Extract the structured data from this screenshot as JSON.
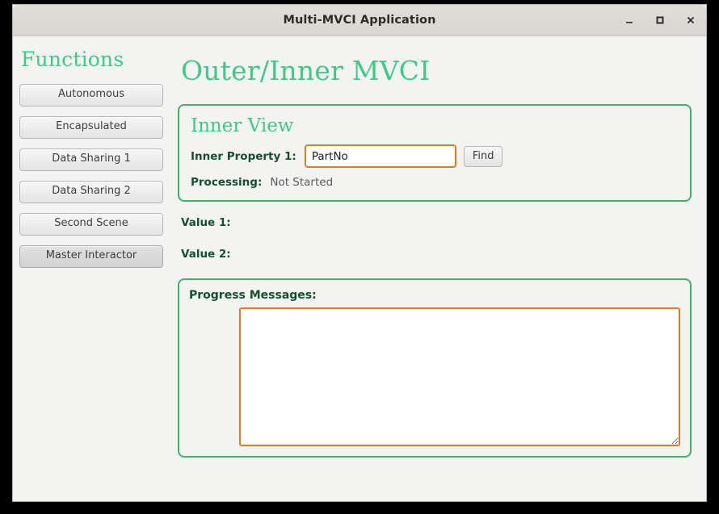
{
  "window": {
    "title": "Multi-MVCI Application",
    "controls": {
      "minimize": "minimize-icon",
      "maximize": "maximize-icon",
      "close": "close-icon"
    }
  },
  "sidebar": {
    "title": "Functions",
    "items": [
      {
        "label": "Autonomous",
        "selected": false
      },
      {
        "label": "Encapsulated",
        "selected": false
      },
      {
        "label": "Data Sharing 1",
        "selected": false
      },
      {
        "label": "Data Sharing 2",
        "selected": false
      },
      {
        "label": "Second Scene",
        "selected": false
      },
      {
        "label": "Master Interactor",
        "selected": true
      }
    ]
  },
  "main": {
    "page_title": "Outer/Inner MVCI",
    "inner_view": {
      "title": "Inner View",
      "property_label": "Inner Property 1:",
      "property_value": "PartNo",
      "property_placeholder": "",
      "find_label": "Find",
      "processing_label": "Processing:",
      "processing_value": "Not Started"
    },
    "value_1_label": "Value 1:",
    "value_1_value": "",
    "value_2_label": "Value 2:",
    "value_2_value": "",
    "progress": {
      "label": "Progress Messages:",
      "text": ""
    }
  },
  "colors": {
    "accent_green": "#3bcb84",
    "panel_border_green": "#3bb467",
    "label_dark_green": "#12502f",
    "input_border_orange": "#e07b20",
    "titlebar": "#dad7d2",
    "content_bg": "#f3f3f2"
  }
}
